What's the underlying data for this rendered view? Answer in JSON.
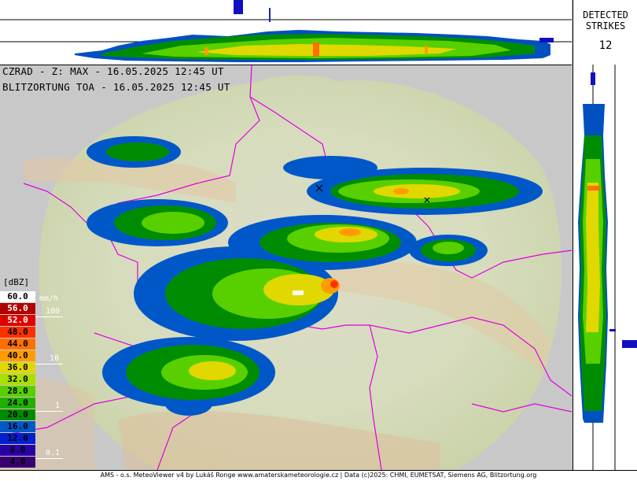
{
  "header": {
    "radar_line": "CZRAD - Z: MAX - 16.05.2025 12:45 UT",
    "lightning_line": "BLITZORTUNG TOA - 16.05.2025 12:45 UT"
  },
  "strikes": {
    "label_line1": "DETECTED",
    "label_line2": "STRIKES",
    "count": "12"
  },
  "legend": {
    "unit": "[dBZ]",
    "rate_unit": "mm/h",
    "levels": [
      {
        "label": "60.0",
        "color": "#ffffff",
        "text": "#000000"
      },
      {
        "label": "56.0",
        "color": "#b00000",
        "text": "#ffffff"
      },
      {
        "label": "52.0",
        "color": "#e00000",
        "text": "#ffffff"
      },
      {
        "label": "48.0",
        "color": "#ff3000",
        "text": "#000000"
      },
      {
        "label": "44.0",
        "color": "#ff7000",
        "text": "#000000"
      },
      {
        "label": "40.0",
        "color": "#ff9c00",
        "text": "#000000"
      },
      {
        "label": "36.0",
        "color": "#e0d800",
        "text": "#000000"
      },
      {
        "label": "32.0",
        "color": "#a8e000",
        "text": "#000000"
      },
      {
        "label": "28.0",
        "color": "#58d000",
        "text": "#000000"
      },
      {
        "label": "24.0",
        "color": "#20b000",
        "text": "#000000"
      },
      {
        "label": "20.0",
        "color": "#008c00",
        "text": "#000000"
      },
      {
        "label": "16.0",
        "color": "#0058c8",
        "text": "#000000"
      },
      {
        "label": "12.0",
        "color": "#0020d0",
        "text": "#000000"
      },
      {
        "label": "8.0",
        "color": "#2800a8",
        "text": "#000000"
      },
      {
        "label": "4.0",
        "color": "#380070",
        "text": "#000000"
      }
    ],
    "rates": [
      "100",
      "10",
      "1",
      "0.1"
    ]
  },
  "footer": {
    "credit": "AMS - o.s. MeteoViewer v4 by Lukáš Ronge www.amaterskameteorologie.cz | Data (c)2025: CHMI, EUMETSAT, Siemens AG, Blitzortung.org"
  }
}
